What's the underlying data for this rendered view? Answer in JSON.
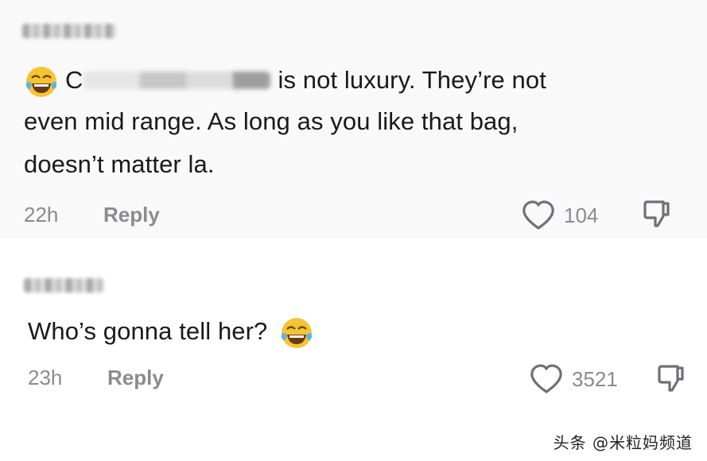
{
  "comments": [
    {
      "text_prefix": "C",
      "text_after": "is not luxury. They’re not",
      "line2": "even mid range. As long as you like that bag,",
      "line3": "doesn’t matter la.",
      "time": "22h",
      "reply_label": "Reply",
      "likes": "104",
      "emoji": "laughing-tears-emoji"
    },
    {
      "text": "Who’s gonna tell her?",
      "time": "23h",
      "reply_label": "Reply",
      "likes": "3521",
      "emoji": "laughing-tears-emoji"
    }
  ],
  "watermark": "头条 @米粒妈频道"
}
